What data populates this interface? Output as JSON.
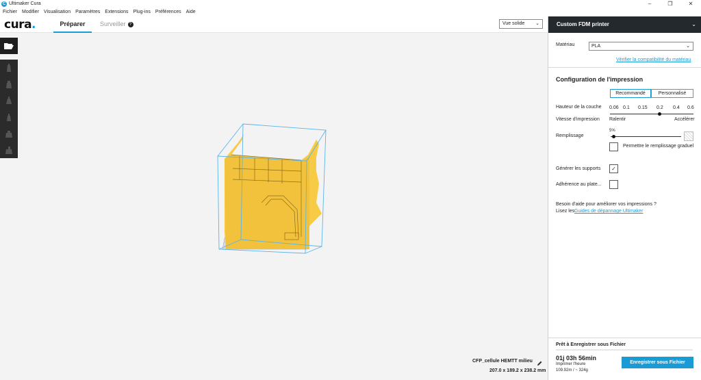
{
  "window": {
    "title": "Ultimaker Cura",
    "minimize": "–",
    "maximize": "❐",
    "close": "✕"
  },
  "menu": [
    "Fichier",
    "Modifier",
    "Visualisation",
    "Paramètres",
    "Extensions",
    "Plug-ins",
    "Préférences",
    "Aide"
  ],
  "header": {
    "brand": "cura",
    "tabs": {
      "prepare": "Préparer",
      "monitor": "Surveiller"
    },
    "view_mode": "Vue solide"
  },
  "toolbar": {
    "tools": [
      "open-folder-icon",
      "move-icon",
      "scale-icon",
      "rotate-icon",
      "mirror-icon",
      "per-model-settings-icon",
      "support-blocker-icon"
    ]
  },
  "sidebar": {
    "machine_name": "Custom FDM printer",
    "material_label": "Matériau",
    "material_value": "PLA",
    "compat_link": "Vérifier la compatibilité du matériau",
    "config_title": "Configuration de l'impression",
    "mode_recommended": "Recommandé",
    "mode_custom": "Personnalisé",
    "layer_height_label": "Hauteur de la couche",
    "layer_heights": [
      "0.06",
      "0.1",
      "0.15",
      "0.2",
      "0.4",
      "0.6"
    ],
    "layer_height_selected": "0.2",
    "speed_label": "Vitesse d'impression",
    "speed_slow": "Ralentir",
    "speed_fast": "Accélérer",
    "infill_label": "Remplissage",
    "infill_value": "5%",
    "infill_fraction": 0.05,
    "gradual_label": "Permettre le remplissage graduel",
    "gradual_checked": false,
    "support_label": "Générer les supports",
    "support_checked": true,
    "adhesion_label": "Adhérence au plate...",
    "adhesion_checked": false,
    "help_line1": "Besoin d'aide pour améliorer vos impressions ?",
    "help_line2": "Lisez les",
    "help_link": "Guides de dépannage Ultimaker"
  },
  "object": {
    "name": "CFP_cellule HEMTT milieu",
    "dimensions": "207.0 x 189.2 x 238.2 mm"
  },
  "output": {
    "title": "Prêt à Enregistrer sous Fichier",
    "time": "01j 03h 56min",
    "time_label": "Imprimer l'heure",
    "usage": "109.92m / ~ 324g",
    "save_button": "Enregistrer sous Fichier"
  },
  "colors": {
    "accent": "#1a9bd6",
    "model": "#f7cb45",
    "dark": "#24292e"
  }
}
